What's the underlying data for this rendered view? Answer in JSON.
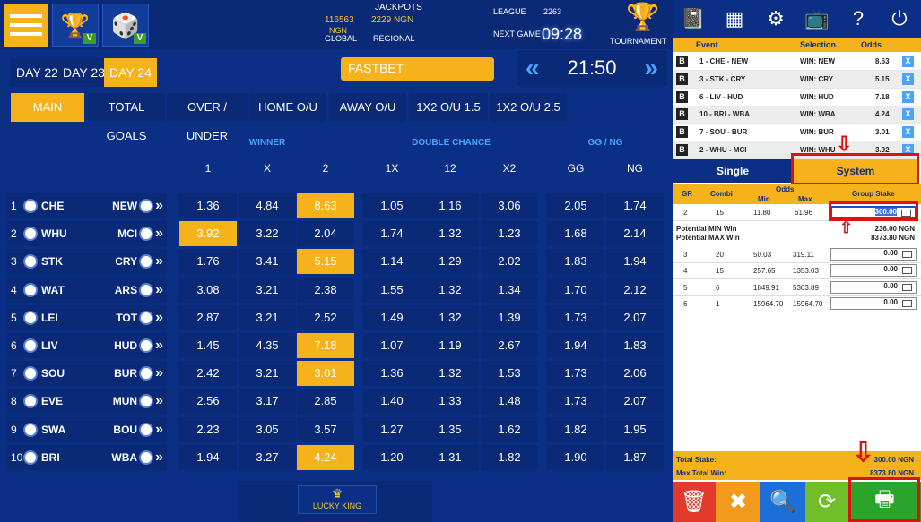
{
  "header": {
    "jackpots_label": "JACKPOTS",
    "global_value": "116563",
    "global_currency": "NGN",
    "global_label": "GLOBAL",
    "regional_value": "2229 NGN",
    "regional_label": "REGIONAL",
    "league_label": "LEAGUE",
    "league_value": "2263",
    "next_game_label": "NEXT GAME",
    "next_game_time": "09:28",
    "tournament_label": "TOURNAMENT"
  },
  "days": [
    "DAY 22",
    "DAY 23",
    "DAY 24"
  ],
  "fastbet": "FASTBET",
  "clock": "21:50",
  "tabs": [
    "MAIN",
    "TOTAL GOALS",
    "OVER / UNDER",
    "HOME O/U",
    "AWAY O/U",
    "1X2 O/U 1.5",
    "1X2 O/U 2.5"
  ],
  "groups": {
    "winner": "WINNER",
    "double": "DOUBLE CHANCE",
    "ggng": "GG / NG"
  },
  "cols": [
    "1",
    "X",
    "2",
    "1X",
    "12",
    "X2",
    "GG",
    "NG"
  ],
  "matches": [
    {
      "n": "1",
      "home": "CHE",
      "away": "NEW",
      "odds": [
        "1.36",
        "4.84",
        "8.63",
        "1.05",
        "1.16",
        "3.06",
        "2.05",
        "1.74"
      ],
      "hl": [
        2
      ]
    },
    {
      "n": "2",
      "home": "WHU",
      "away": "MCI",
      "odds": [
        "3.92",
        "3.22",
        "2.04",
        "1.74",
        "1.32",
        "1.23",
        "1.68",
        "2.14"
      ],
      "hl": [
        0
      ]
    },
    {
      "n": "3",
      "home": "STK",
      "away": "CRY",
      "odds": [
        "1.76",
        "3.41",
        "5.15",
        "1.14",
        "1.29",
        "2.02",
        "1.83",
        "1.94"
      ],
      "hl": [
        2
      ]
    },
    {
      "n": "4",
      "home": "WAT",
      "away": "ARS",
      "odds": [
        "3.08",
        "3.21",
        "2.38",
        "1.55",
        "1.32",
        "1.34",
        "1.70",
        "2.12"
      ],
      "hl": []
    },
    {
      "n": "5",
      "home": "LEI",
      "away": "TOT",
      "odds": [
        "2.87",
        "3.21",
        "2.52",
        "1.49",
        "1.32",
        "1.39",
        "1.73",
        "2.07"
      ],
      "hl": []
    },
    {
      "n": "6",
      "home": "LIV",
      "away": "HUD",
      "odds": [
        "1.45",
        "4.35",
        "7.18",
        "1.07",
        "1.19",
        "2.67",
        "1.94",
        "1.83"
      ],
      "hl": [
        2
      ]
    },
    {
      "n": "7",
      "home": "SOU",
      "away": "BUR",
      "odds": [
        "2.42",
        "3.21",
        "3.01",
        "1.36",
        "1.32",
        "1.53",
        "1.73",
        "2.06"
      ],
      "hl": [
        2
      ]
    },
    {
      "n": "8",
      "home": "EVE",
      "away": "MUN",
      "odds": [
        "2.56",
        "3.17",
        "2.85",
        "1.40",
        "1.33",
        "1.48",
        "1.73",
        "2.07"
      ],
      "hl": []
    },
    {
      "n": "9",
      "home": "SWA",
      "away": "BOU",
      "odds": [
        "2.23",
        "3.05",
        "3.57",
        "1.27",
        "1.35",
        "1.62",
        "1.82",
        "1.95"
      ],
      "hl": []
    },
    {
      "n": "10",
      "home": "BRI",
      "away": "WBA",
      "odds": [
        "1.94",
        "3.27",
        "4.24",
        "1.20",
        "1.31",
        "1.82",
        "1.90",
        "1.87"
      ],
      "hl": [
        2
      ]
    }
  ],
  "ticket": {
    "h_event": "Event",
    "h_sel": "Selection",
    "h_odds": "Odds",
    "rows": [
      {
        "event": "1 - CHE - NEW",
        "sel": "WIN: NEW",
        "odds": "8.63"
      },
      {
        "event": "3 - STK - CRY",
        "sel": "WIN: CRY",
        "odds": "5.15"
      },
      {
        "event": "6 - LIV - HUD",
        "sel": "WIN: HUD",
        "odds": "7.18"
      },
      {
        "event": "10 - BRI - WBA",
        "sel": "WIN: WBA",
        "odds": "4.24"
      },
      {
        "event": "7 - SOU - BUR",
        "sel": "WIN: BUR",
        "odds": "3.01"
      },
      {
        "event": "2 - WHU - MCI",
        "sel": "WIN: WHU",
        "odds": "3.92"
      }
    ],
    "bmark": "B",
    "xmark": "X"
  },
  "betmode": {
    "single": "Single",
    "system": "System"
  },
  "system": {
    "h_gr": "GR",
    "h_combi": "Combi",
    "h_odds": "Odds",
    "h_min": "Min",
    "h_max": "Max",
    "h_stake": "Group Stake",
    "first": {
      "gr": "2",
      "combi": "15",
      "min": "11.80",
      "max": "61.96",
      "stake": "300.00"
    },
    "pot_min_label": "Potential MIN Win",
    "pot_min": "236.00 NGN",
    "pot_max_label": "Potential MAX Win",
    "pot_max": "8373.80 NGN",
    "rows": [
      {
        "gr": "3",
        "combi": "20",
        "min": "50.03",
        "max": "319.11",
        "stake": "0.00"
      },
      {
        "gr": "4",
        "combi": "15",
        "min": "257.65",
        "max": "1353.03",
        "stake": "0.00"
      },
      {
        "gr": "5",
        "combi": "6",
        "min": "1849.91",
        "max": "5303.89",
        "stake": "0.00"
      },
      {
        "gr": "6",
        "combi": "1",
        "min": "15964.70",
        "max": "15964.70",
        "stake": "0.00"
      }
    ]
  },
  "totals": {
    "stake_label": "Total Stake:",
    "stake": "300.00 NGN",
    "maxwin_label": "Max Total Win:",
    "maxwin": "8373.80 NGN"
  },
  "logo_text": "LUCKY KING",
  "colors": {
    "accent": "#f6b21a",
    "bg": "#0a2f84",
    "cell": "#0a2a78",
    "highlight": "#e01010"
  }
}
